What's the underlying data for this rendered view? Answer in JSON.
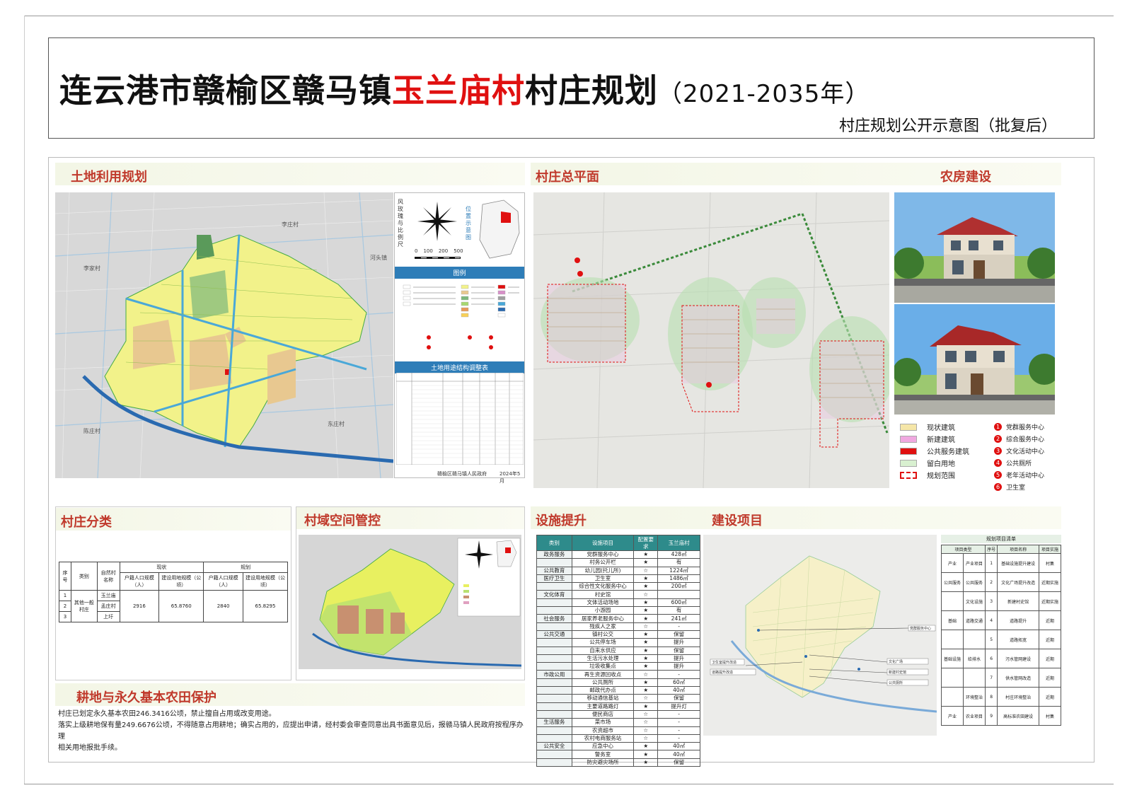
{
  "header": {
    "title_part1": "连云港市赣榆区赣马镇",
    "title_red": "玉兰庙村",
    "title_part2": "村庄规划",
    "title_years": "（2021-2035年）",
    "subtitle": "村庄规划公开示意图（批复后）"
  },
  "sections": {
    "land_use": "土地利用规划",
    "master_plan": "村庄总平面",
    "housing": "农房建设",
    "classification": "村庄分类",
    "space_control": "村域空间管控",
    "facilities": "设施提升",
    "projects": "建设项目",
    "farmland": "耕地与永久基本农田保护"
  },
  "land_use_map": {
    "wind_rose_label": "风玫瑰与比例尺",
    "location_label": "位置示意图",
    "scale_labels": [
      "0",
      "100",
      "200",
      "500"
    ],
    "legend_title": "图例",
    "table_title": "土地用途结构调整表",
    "footer_org": "赣榆区赣马镇人民政府",
    "footer_date": "2024年5月",
    "village_labels": [
      "李庄村",
      "河头镇",
      "李家村",
      "东庄村",
      "陈庄村"
    ]
  },
  "master_plan": {
    "legend": [
      {
        "label": "现状建筑",
        "color": "#f5e6a8"
      },
      {
        "label": "新建建筑",
        "color": "#f0a8e0"
      },
      {
        "label": "公共服务建筑",
        "color": "#e01010"
      },
      {
        "label": "留白用地",
        "color": "#d8f0d0"
      },
      {
        "label": "规划范围",
        "color": "#e01010"
      }
    ],
    "numbered": [
      {
        "n": "1",
        "label": "党群服务中心"
      },
      {
        "n": "2",
        "label": "综合服务中心"
      },
      {
        "n": "3",
        "label": "文化活动中心"
      },
      {
        "n": "4",
        "label": "公共厕所"
      },
      {
        "n": "5",
        "label": "老年活动中心"
      },
      {
        "n": "6",
        "label": "卫生室"
      }
    ]
  },
  "classification_table": {
    "head_row1": [
      "序号",
      "类别",
      "自然村名称",
      "现状",
      "规划"
    ],
    "head_row2": [
      "户籍人口规模（人）",
      "建设用地规模（公顷）",
      "户籍人口规模（人）",
      "建设用地规模（公顷）"
    ],
    "rows": [
      {
        "no": "1",
        "village": "玉兰庙"
      },
      {
        "no": "2",
        "village": "孟庄村"
      },
      {
        "no": "3",
        "village": "上圩"
      }
    ],
    "category": "其他一般村庄",
    "pop_now": "2916",
    "land_now": "65.8760",
    "pop_plan": "2840",
    "land_plan": "65.8295"
  },
  "facilities": {
    "headers": [
      "类别",
      "设施项目",
      "配置要求",
      "玉兰庙村"
    ],
    "rows": [
      {
        "cat": "政务服务",
        "item": "党群服务中心",
        "req": "★",
        "val": "428㎡"
      },
      {
        "cat": "",
        "item": "村务公开栏",
        "req": "★",
        "val": "有"
      },
      {
        "cat": "公共教育",
        "item": "幼儿园(托儿所)",
        "req": "☆",
        "val": "1224㎡"
      },
      {
        "cat": "医疗卫生",
        "item": "卫生室",
        "req": "★",
        "val": "1486㎡"
      },
      {
        "cat": "",
        "item": "综合性文化服务中心",
        "req": "★",
        "val": "200㎡"
      },
      {
        "cat": "文化体育",
        "item": "村史馆",
        "req": "☆",
        "val": ""
      },
      {
        "cat": "",
        "item": "文体活动场地",
        "req": "★",
        "val": "600㎡"
      },
      {
        "cat": "",
        "item": "小游园",
        "req": "★",
        "val": "有"
      },
      {
        "cat": "社会服务",
        "item": "居家养老服务中心",
        "req": "★",
        "val": "241㎡"
      },
      {
        "cat": "",
        "item": "残疾人之家",
        "req": "☆",
        "val": "-"
      },
      {
        "cat": "公共交通",
        "item": "镇村公交",
        "req": "★",
        "val": "保留"
      },
      {
        "cat": "",
        "item": "公共停车场",
        "req": "★",
        "val": "提升"
      },
      {
        "cat": "",
        "item": "自来水供应",
        "req": "★",
        "val": "保留"
      },
      {
        "cat": "",
        "item": "生活污水处理",
        "req": "★",
        "val": "提升"
      },
      {
        "cat": "",
        "item": "垃圾收集点",
        "req": "★",
        "val": "提升"
      },
      {
        "cat": "市政公用",
        "item": "再生资源回收点",
        "req": "☆",
        "val": "-"
      },
      {
        "cat": "",
        "item": "公共厕所",
        "req": "★",
        "val": "60㎡"
      },
      {
        "cat": "",
        "item": "邮政代办点",
        "req": "★",
        "val": "40㎡"
      },
      {
        "cat": "",
        "item": "移动通信基站",
        "req": "☆",
        "val": "保留"
      },
      {
        "cat": "",
        "item": "主要道路路灯",
        "req": "★",
        "val": "提升灯"
      },
      {
        "cat": "",
        "item": "便民商店",
        "req": "☆",
        "val": "-"
      },
      {
        "cat": "生活服务",
        "item": "菜市场",
        "req": "☆",
        "val": "-"
      },
      {
        "cat": "",
        "item": "农资超市",
        "req": "☆",
        "val": "-"
      },
      {
        "cat": "",
        "item": "农村电商服务站",
        "req": "☆",
        "val": "-"
      },
      {
        "cat": "公共安全",
        "item": "应急中心",
        "req": "★",
        "val": "40㎡"
      },
      {
        "cat": "",
        "item": "警务室",
        "req": "★",
        "val": "40㎡"
      },
      {
        "cat": "",
        "item": "防灾避灾场所",
        "req": "★",
        "val": "保留"
      }
    ]
  },
  "projects": {
    "table_title": "规划项目清单",
    "headers": [
      "项目类型",
      "序号",
      "项目名称",
      "项目实施"
    ],
    "rows": [
      {
        "type": "产业",
        "sub": "产业项目",
        "no": "1",
        "name": "基础设施提升建设",
        "impl": "村集"
      },
      {
        "type": "公共服务",
        "sub": "公共服务",
        "no": "2",
        "name": "文化广场提升改造",
        "impl": "近期实施"
      },
      {
        "type": "",
        "sub": "文化设施",
        "no": "3",
        "name": "新建村史馆",
        "impl": "近期实施"
      },
      {
        "type": "基础",
        "sub": "道路交通",
        "no": "4",
        "name": "道路提升",
        "impl": "近期"
      },
      {
        "type": "",
        "sub": "",
        "no": "5",
        "name": "道路拓宽",
        "impl": "近期"
      },
      {
        "type": "基础设施",
        "sub": "给排水",
        "no": "6",
        "name": "污水管网建设",
        "impl": "近期"
      },
      {
        "type": "",
        "sub": "",
        "no": "7",
        "name": "供水管网改造",
        "impl": "近期"
      },
      {
        "type": "",
        "sub": "环境整治",
        "no": "8",
        "name": "村庄环境整治",
        "impl": "近期"
      },
      {
        "type": "产业",
        "sub": "农业项目",
        "no": "9",
        "name": "高标准农田建设",
        "impl": "村集"
      }
    ],
    "map_labels": [
      "党群服务中心",
      "文化广场",
      "新建村史馆",
      "公共厕所",
      "卫生室提升改造",
      "道路提升改造"
    ]
  },
  "farmland": {
    "line1": "村庄已划定永久基本农田246.3416公顷，禁止擅自占用或改变用途。",
    "line2": "落实上级耕地保有量249.6676公顷，不得随意占用耕地；确实占用的，应提出申请，经村委会审查同意出具书面意见后，报赣马镇人民政府按程序办理",
    "line3": "相关用地报批手续。"
  }
}
